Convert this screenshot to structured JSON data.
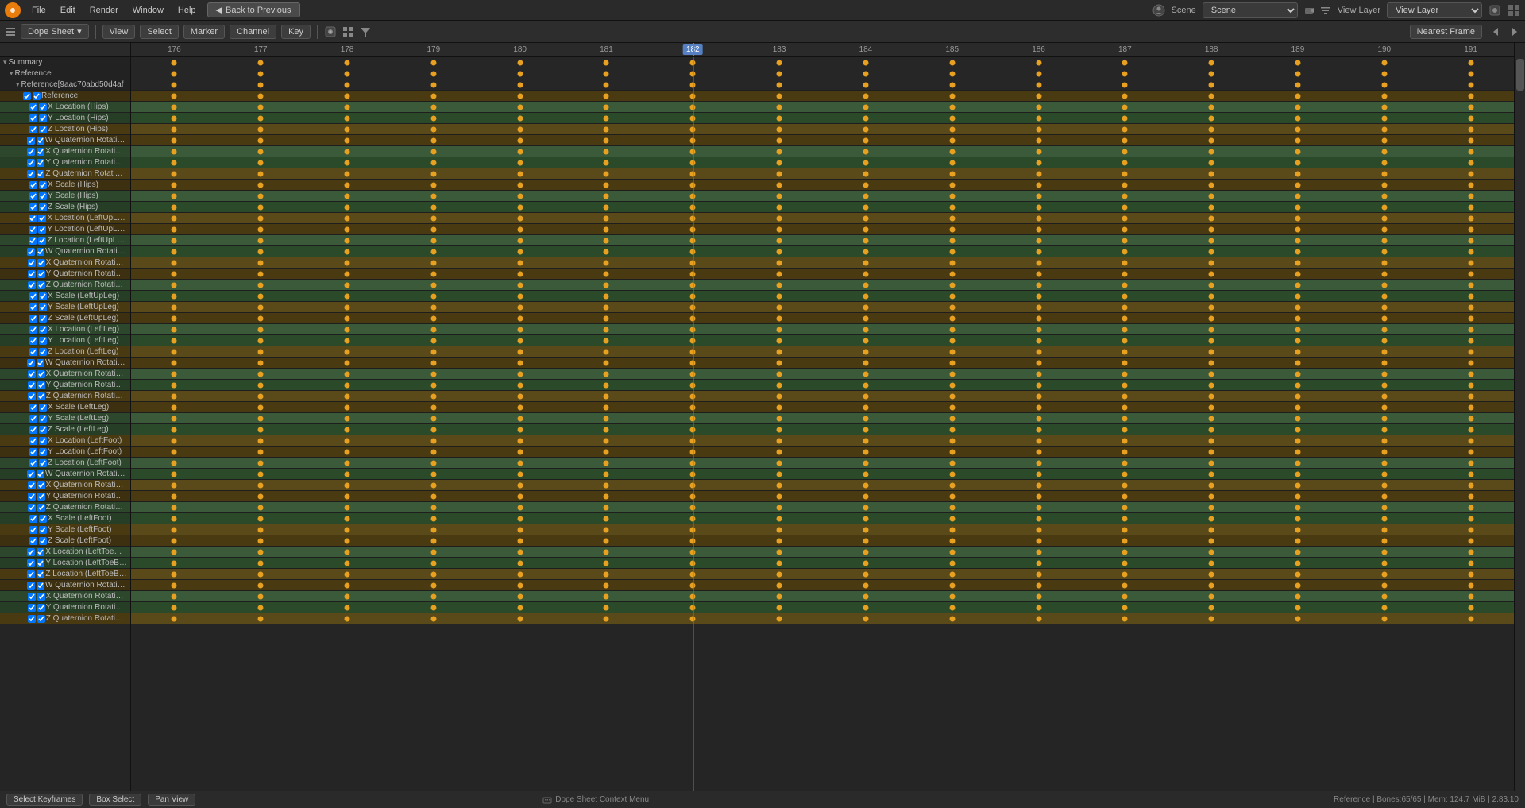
{
  "topbar": {
    "app_icon": "B",
    "menu": [
      "File",
      "Edit",
      "Render",
      "Window",
      "Help"
    ],
    "back_btn": "Back to Previous",
    "scene_label": "Scene",
    "view_layer_label": "View Layer"
  },
  "toolbar": {
    "editor_type": "Dope Sheet",
    "view_label": "View",
    "select_label": "Select",
    "marker_label": "Marker",
    "channel_label": "Channel",
    "key_label": "Key",
    "filter_icon": "⊞",
    "nearest_frame": "Nearest Frame"
  },
  "frames": [
    176,
    177,
    178,
    179,
    180,
    181,
    182,
    183,
    184,
    185,
    186,
    187,
    188,
    189,
    190,
    191
  ],
  "current_frame": 182,
  "channels": [
    {
      "label": "Summary",
      "indent": 0,
      "type": "group"
    },
    {
      "label": "Reference",
      "indent": 1,
      "type": "group"
    },
    {
      "label": "Reference[9aac70abd50d4af",
      "indent": 2,
      "type": "group"
    },
    {
      "label": "Reference",
      "indent": 3,
      "type": "item"
    },
    {
      "label": "X Location (Hips)",
      "indent": 4,
      "type": "item"
    },
    {
      "label": "Y Location (Hips)",
      "indent": 4,
      "type": "item"
    },
    {
      "label": "Z Location (Hips)",
      "indent": 4,
      "type": "item"
    },
    {
      "label": "W Quaternion Rotation (H",
      "indent": 4,
      "type": "item"
    },
    {
      "label": "X Quaternion Rotation (H",
      "indent": 4,
      "type": "item"
    },
    {
      "label": "Y Quaternion Rotation (H",
      "indent": 4,
      "type": "item"
    },
    {
      "label": "Z Quaternion Rotation (H",
      "indent": 4,
      "type": "item"
    },
    {
      "label": "X Scale (Hips)",
      "indent": 4,
      "type": "item"
    },
    {
      "label": "Y Scale (Hips)",
      "indent": 4,
      "type": "item"
    },
    {
      "label": "Z Scale (Hips)",
      "indent": 4,
      "type": "item"
    },
    {
      "label": "X Location (LeftUpLeg)",
      "indent": 4,
      "type": "item"
    },
    {
      "label": "Y Location (LeftUpLeg)",
      "indent": 4,
      "type": "item"
    },
    {
      "label": "Z Location (LeftUpLeg)",
      "indent": 4,
      "type": "item"
    },
    {
      "label": "W Quaternion Rotation (L",
      "indent": 4,
      "type": "item"
    },
    {
      "label": "X Quaternion Rotation (L",
      "indent": 4,
      "type": "item"
    },
    {
      "label": "Y Quaternion Rotation (L",
      "indent": 4,
      "type": "item"
    },
    {
      "label": "Z Quaternion Rotation (L",
      "indent": 4,
      "type": "item"
    },
    {
      "label": "X Scale (LeftUpLeg)",
      "indent": 4,
      "type": "item"
    },
    {
      "label": "Y Scale (LeftUpLeg)",
      "indent": 4,
      "type": "item"
    },
    {
      "label": "Z Scale (LeftUpLeg)",
      "indent": 4,
      "type": "item"
    },
    {
      "label": "X Location (LeftLeg)",
      "indent": 4,
      "type": "item"
    },
    {
      "label": "Y Location (LeftLeg)",
      "indent": 4,
      "type": "item"
    },
    {
      "label": "Z Location (LeftLeg)",
      "indent": 4,
      "type": "item"
    },
    {
      "label": "W Quaternion Rotation (L",
      "indent": 4,
      "type": "item"
    },
    {
      "label": "X Quaternion Rotation (L",
      "indent": 4,
      "type": "item"
    },
    {
      "label": "Y Quaternion Rotation (L",
      "indent": 4,
      "type": "item"
    },
    {
      "label": "Z Quaternion Rotation (L",
      "indent": 4,
      "type": "item"
    },
    {
      "label": "X Scale (LeftLeg)",
      "indent": 4,
      "type": "item"
    },
    {
      "label": "Y Scale (LeftLeg)",
      "indent": 4,
      "type": "item"
    },
    {
      "label": "Z Scale (LeftLeg)",
      "indent": 4,
      "type": "item"
    },
    {
      "label": "X Location (LeftFoot)",
      "indent": 4,
      "type": "item"
    },
    {
      "label": "Y Location (LeftFoot)",
      "indent": 4,
      "type": "item"
    },
    {
      "label": "Z Location (LeftFoot)",
      "indent": 4,
      "type": "item"
    },
    {
      "label": "W Quaternion Rotation (L",
      "indent": 4,
      "type": "item"
    },
    {
      "label": "X Quaternion Rotation (L",
      "indent": 4,
      "type": "item"
    },
    {
      "label": "Y Quaternion Rotation (L",
      "indent": 4,
      "type": "item"
    },
    {
      "label": "Z Quaternion Rotation (L",
      "indent": 4,
      "type": "item"
    },
    {
      "label": "X Scale (LeftFoot)",
      "indent": 4,
      "type": "item"
    },
    {
      "label": "Y Scale (LeftFoot)",
      "indent": 4,
      "type": "item"
    },
    {
      "label": "Z Scale (LeftFoot)",
      "indent": 4,
      "type": "item"
    },
    {
      "label": "X Location (LeftToeBase)",
      "indent": 4,
      "type": "item"
    },
    {
      "label": "Y Location (LeftToeBase)",
      "indent": 4,
      "type": "item"
    },
    {
      "label": "Z Location (LeftToeBase)",
      "indent": 4,
      "type": "item"
    },
    {
      "label": "W Quaternion Rotation (L",
      "indent": 4,
      "type": "item"
    },
    {
      "label": "X Quaternion Rotation (L",
      "indent": 4,
      "type": "item"
    },
    {
      "label": "Y Quaternion Rotation (L",
      "indent": 4,
      "type": "item"
    },
    {
      "label": "Z Quaternion Rotation (L",
      "indent": 4,
      "type": "item"
    }
  ],
  "status": {
    "select_keyframes": "Select Keyframes",
    "box_select": "Box Select",
    "pan_view": "Pan View",
    "context_menu": "Dope Sheet Context Menu",
    "right_info": "Reference | Bones:65/65 | Mem: 124.7 MiB | 2.83.10"
  }
}
